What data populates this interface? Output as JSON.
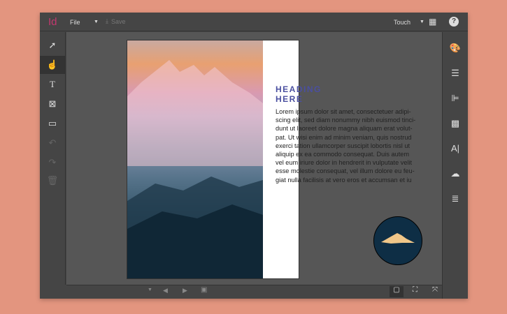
{
  "app": {
    "logo": "Id",
    "file_menu": "File",
    "save_label": "Save",
    "mode": "Touch"
  },
  "left_tools": [
    "selection-tool",
    "touch-tool",
    "type-tool",
    "frame-tool",
    "rectangle-tool",
    "undo",
    "redo",
    "delete"
  ],
  "right_panels": [
    "swatches",
    "menu",
    "align",
    "pattern",
    "text",
    "creative-cloud",
    "list"
  ],
  "document": {
    "heading": "HEADING HERE",
    "body": "Lorem ipsum dolor sit amet, consectetuer adipi-\nscing elit, sed diam nonummy nibh euismod tinci-\ndunt ut laoreet dolore magna aliquam erat volut-\npat. Ut wisi enim ad minim veniam, quis nostrud\nexerci tation ullamcorper suscipit lobortis nisl ut\naliquip ex ea commodo consequat. Duis autem\nvel eum iriure dolor in hendrerit in vulputate velit\nesse molestie consequat, vel illum dolore eu feu-\ngiat nulla facilisis at vero eros et accumsan et iu"
  },
  "colors": {
    "accent": "#c4386f",
    "heading": "#4a4fa0",
    "background": "#e3957f"
  }
}
